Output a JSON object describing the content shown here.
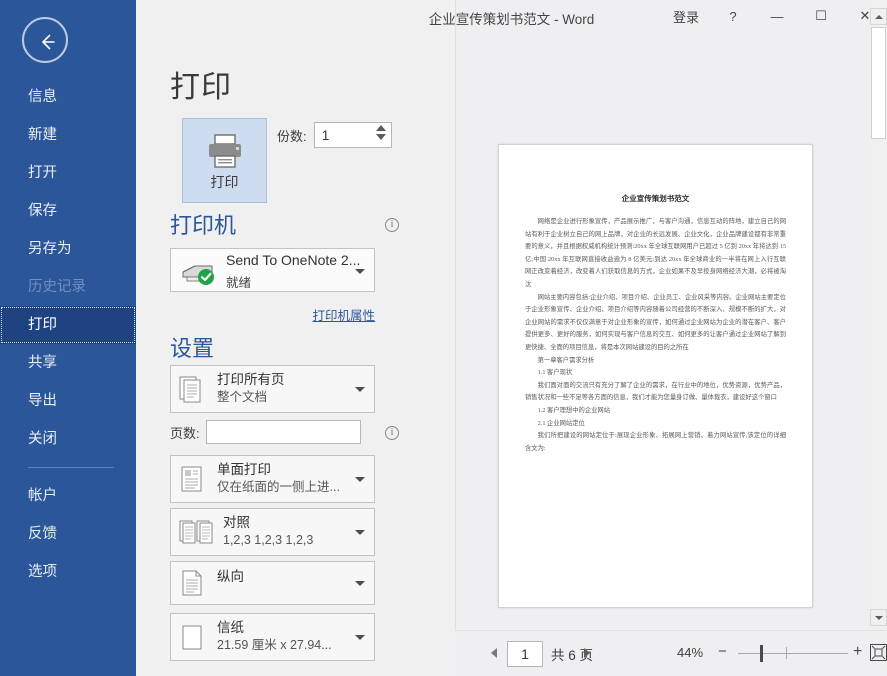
{
  "window": {
    "title": "企业宣传策划书范文  -  Word",
    "signin_label": "登录",
    "help_label": "?",
    "minimize_label": "—",
    "maximize_label": "☐",
    "close_label": "✕"
  },
  "sidebar": {
    "back_icon": "back-arrow-icon",
    "accent_color": "#2b579a",
    "selected_color": "#1f4280",
    "items": [
      {
        "label": "信息",
        "state": "normal"
      },
      {
        "label": "新建",
        "state": "normal"
      },
      {
        "label": "打开",
        "state": "normal"
      },
      {
        "label": "保存",
        "state": "normal"
      },
      {
        "label": "另存为",
        "state": "normal"
      },
      {
        "label": "历史记录",
        "state": "disabled"
      },
      {
        "label": "打印",
        "state": "selected"
      },
      {
        "label": "共享",
        "state": "normal"
      },
      {
        "label": "导出",
        "state": "normal"
      },
      {
        "label": "关闭",
        "state": "normal"
      }
    ],
    "items_bottom": [
      {
        "label": "帐户",
        "state": "normal"
      },
      {
        "label": "反馈",
        "state": "normal"
      },
      {
        "label": "选项",
        "state": "normal"
      }
    ]
  },
  "print": {
    "page_title": "打印",
    "print_button_label": "打印",
    "print_button_icon": "printer-icon",
    "copies_label": "份数:",
    "copies_value": "1",
    "printer_section_title": "打印机",
    "printer_info_icon": "info-icon",
    "printer_name": "Send To OneNote 2...",
    "printer_status": "就绪",
    "printer_icon": "printer-ready-icon",
    "printer_properties_link": "打印机属性",
    "settings_section_title": "设置",
    "pages_label": "页数:",
    "pages_value": "",
    "pages_info_icon": "info-icon",
    "options": [
      {
        "id": "print-range",
        "icon": "document-pages-icon",
        "primary": "打印所有页",
        "secondary": "整个文档"
      },
      {
        "id": "print-sides",
        "icon": "one-sided-icon",
        "primary": "单面打印",
        "secondary": "仅在纸面的一侧上进..."
      },
      {
        "id": "collation",
        "icon": "collate-icon",
        "primary": "对照",
        "secondary": "1,2,3    1,2,3    1,2,3"
      },
      {
        "id": "orientation",
        "icon": "portrait-icon",
        "primary": "纵向",
        "secondary": ""
      },
      {
        "id": "paper-size",
        "icon": "paper-icon",
        "primary": "信纸",
        "secondary": "21.59 厘米 x 27.94..."
      }
    ]
  },
  "preview": {
    "document_title": "企业宣传策划书范文",
    "paragraphs": [
      "网络是企业进行形象宣传，产品展示推广，与客户沟通，信息互动的阵地，建立自己的网站有利于企业树立自己的网上品牌，对企业的长远发展、企业文化，企业品牌建设都有非常重要的意义，并且根据权威机构统计预测:20xx 年全球互联网用户已超过 5 亿到 20xx 年将达到 15 亿;中国 20xx 年互联网直接收益逾为 8 亿美元;到达 20xx 年全球商业的一半将在网上入行互联网正改变着经济，改变着人们获取信息的方式，企业如果不及早投身网络经济大潮，必将被淘汰",
      "网站主要内容包括:企业介绍、项目介绍、企业员工、企业风采等内容。企业网站主要定位于企业形象宣传、企业介绍、项目介绍等内容随着公司经营的不断深入、规模不断的扩大，对企业网站的需求不仅仅满意于对企业形象的宣传，如何通过企业网站为企业的潜在客户、客户提供更多、更好的服务，如何实现与客户信息的交互、如何更多的让客户通过企业网站了解到更快捷、全面的项目信息，将是本次网站建设的目的之所在",
      "第一章客户需求分析",
      "1.1 客户现状",
      "我们面对面的交流只有充分了解了企业的需求，在行业中的地位，优势资源，优势产品，销售状况和一些不足等各方面的信息，我们才能为您量身订做、量体裁衣，建设好这个窗口",
      "1.2 客户理想中的企业网站",
      "2.1 企业网站定位",
      "我们所把建设的网站定位于:展现企业形象、拓展网上营销、着力网站宣传,该定位的详细含文为:"
    ]
  },
  "status": {
    "prev_icon": "chevron-left-icon",
    "next_icon": "chevron-right-icon",
    "current_page": "1",
    "page_total_label": "共 6 页",
    "zoom_level": "44%",
    "zoom_out_label": "−",
    "zoom_in_label": "+",
    "fit_page_icon": "fit-to-page-icon"
  }
}
